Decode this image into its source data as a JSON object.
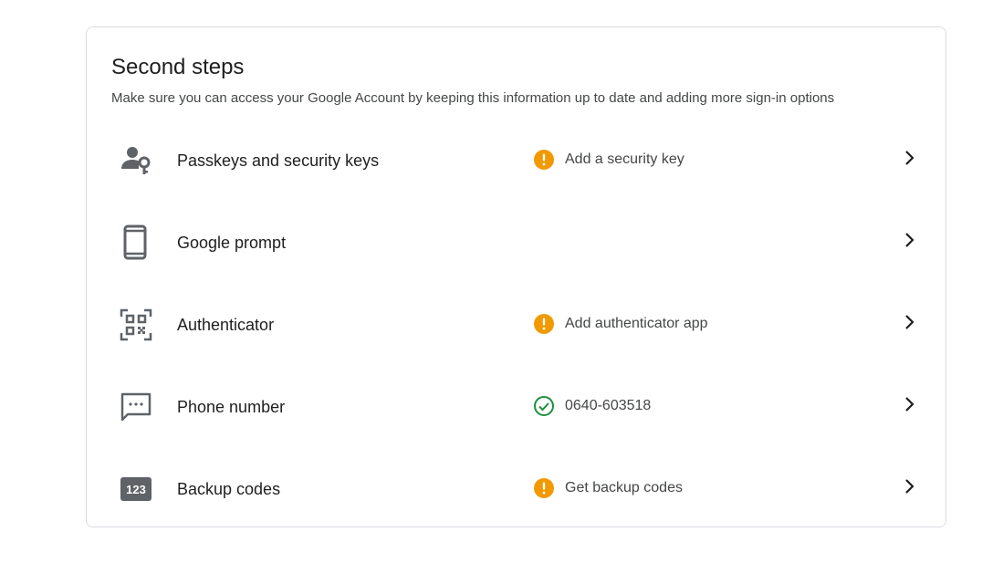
{
  "section": {
    "title": "Second steps",
    "subtitle": "Make sure you can access your Google Account by keeping this information up to date and adding more sign-in options"
  },
  "colors": {
    "warning": "#f29900",
    "success": "#1e8e3e",
    "icon": "#5f6368",
    "chevron": "#1f1f1f"
  },
  "rows": [
    {
      "label": "Passkeys and security keys",
      "icon": "person-key-icon",
      "status_type": "warning",
      "status_text": "Add a security key"
    },
    {
      "label": "Google prompt",
      "icon": "smartphone-icon",
      "status_type": "none",
      "status_text": ""
    },
    {
      "label": "Authenticator",
      "icon": "qr-code-scanner-icon",
      "status_type": "warning",
      "status_text": "Add authenticator app"
    },
    {
      "label": "Phone number",
      "icon": "sms-message-icon",
      "status_type": "success",
      "status_text": "0640-603518"
    },
    {
      "label": "Backup codes",
      "icon": "backup-codes-123-icon",
      "status_type": "warning",
      "status_text": "Get backup codes"
    }
  ]
}
